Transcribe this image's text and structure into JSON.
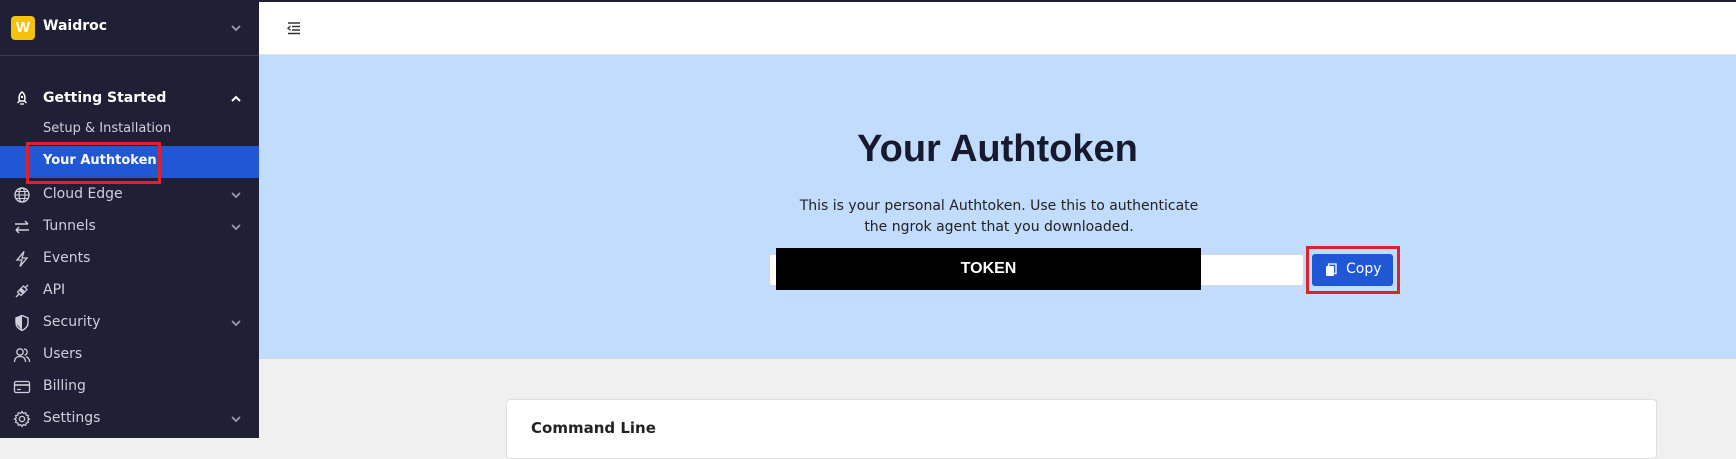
{
  "org": {
    "logo_letter": "W",
    "name": "Waidroc"
  },
  "sidebar": {
    "section": {
      "label": "Getting Started",
      "icon": "rocket-icon"
    },
    "sub_items": [
      {
        "label": "Setup & Installation"
      },
      {
        "label": "Your Authtoken",
        "active": true
      }
    ],
    "items": [
      {
        "label": "Cloud Edge",
        "icon": "globe-icon",
        "expandable": true
      },
      {
        "label": "Tunnels",
        "icon": "arrows-icon",
        "expandable": true
      },
      {
        "label": "Events",
        "icon": "bolt-icon",
        "expandable": false
      },
      {
        "label": "API",
        "icon": "plug-icon",
        "expandable": false
      },
      {
        "label": "Security",
        "icon": "shield-icon",
        "expandable": true
      },
      {
        "label": "Users",
        "icon": "users-icon",
        "expandable": false
      },
      {
        "label": "Billing",
        "icon": "card-icon",
        "expandable": false
      },
      {
        "label": "Settings",
        "icon": "gear-icon",
        "expandable": true
      }
    ]
  },
  "hero": {
    "title": "Your Authtoken",
    "description": "This is your personal Authtoken. Use this to authenticate the ngrok agent that you downloaded.",
    "token_placeholder": "TOKEN",
    "copy_label": "Copy"
  },
  "card": {
    "title": "Command Line"
  },
  "colors": {
    "sidebar_bg": "#1f2036",
    "accent": "#2057d4",
    "hero_bg": "#c2dcfd",
    "highlight": "#e0202a"
  }
}
